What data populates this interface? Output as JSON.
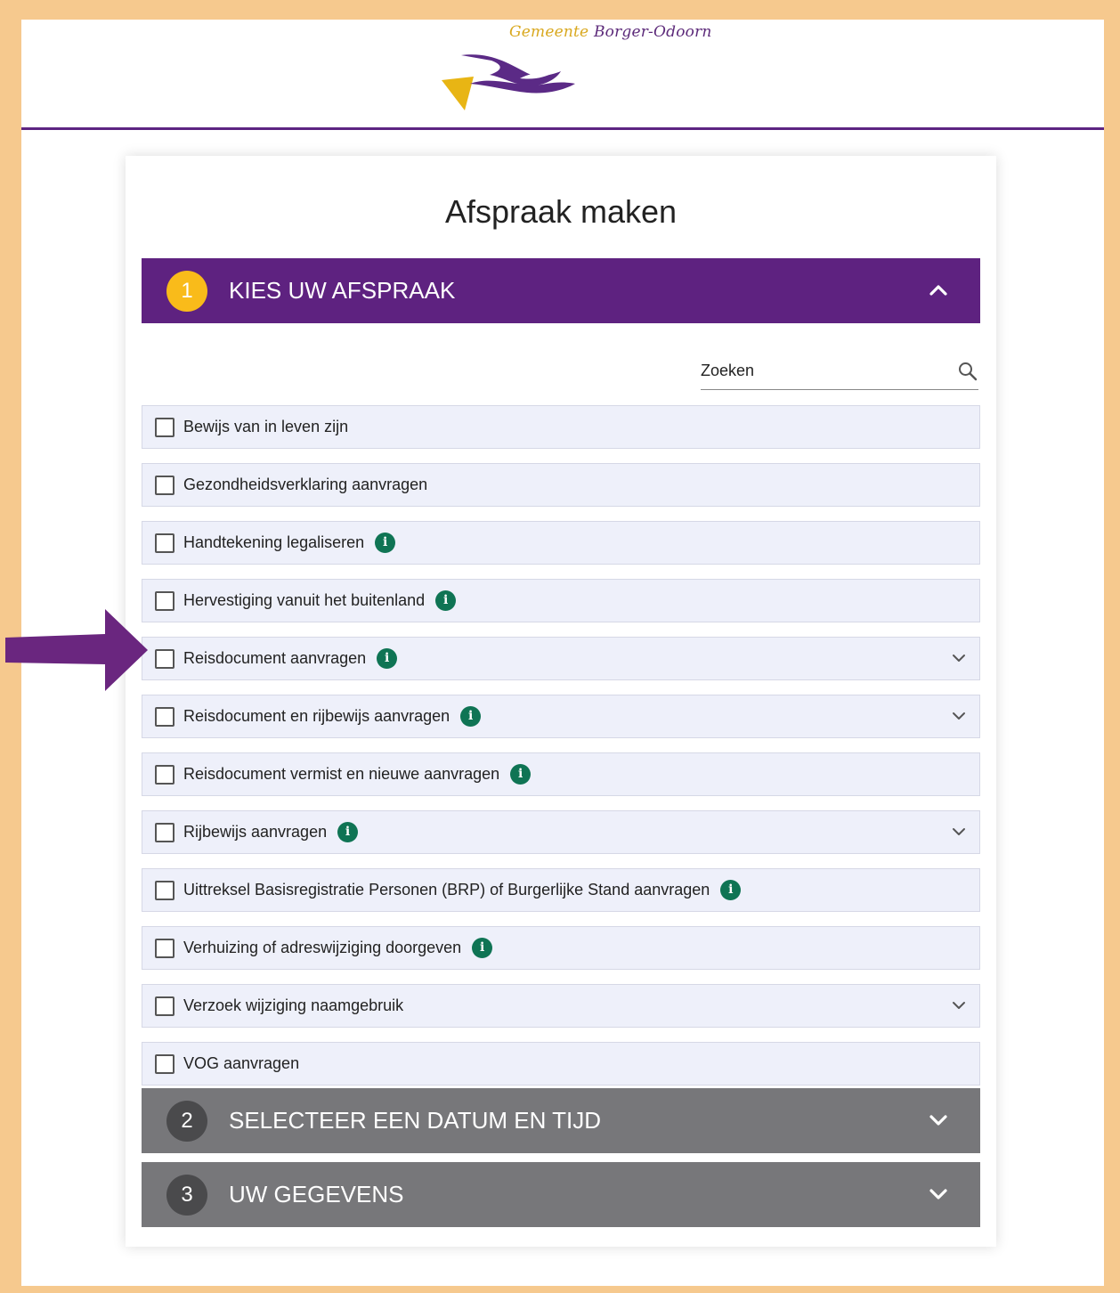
{
  "header": {
    "brand_prefix": "Gemeente",
    "brand_name": "Borger-Odoorn"
  },
  "page": {
    "title": "Afspraak maken"
  },
  "steps": [
    {
      "number": "1",
      "title": "KIES UW AFSPRAAK",
      "state": "expanded"
    },
    {
      "number": "2",
      "title": "SELECTEER EEN DATUM EN TIJD",
      "state": "collapsed"
    },
    {
      "number": "3",
      "title": "UW GEGEVENS",
      "state": "collapsed"
    }
  ],
  "search": {
    "placeholder": "Zoeken",
    "value": ""
  },
  "appointments": [
    {
      "label": "Bewijs van in leven zijn",
      "info": false,
      "expandable": false,
      "checked": false
    },
    {
      "label": "Gezondheidsverklaring aanvragen",
      "info": false,
      "expandable": false,
      "checked": false
    },
    {
      "label": "Handtekening legaliseren",
      "info": true,
      "expandable": false,
      "checked": false
    },
    {
      "label": "Hervestiging vanuit het buitenland",
      "info": true,
      "expandable": false,
      "checked": false
    },
    {
      "label": "Reisdocument aanvragen",
      "info": true,
      "expandable": true,
      "checked": false
    },
    {
      "label": "Reisdocument en rijbewijs aanvragen",
      "info": true,
      "expandable": true,
      "checked": false
    },
    {
      "label": "Reisdocument vermist en nieuwe aanvragen",
      "info": true,
      "expandable": false,
      "checked": false
    },
    {
      "label": "Rijbewijs aanvragen",
      "info": true,
      "expandable": true,
      "checked": false
    },
    {
      "label": "Uittreksel Basisregistratie Personen (BRP) of Burgerlijke Stand aanvragen",
      "info": true,
      "expandable": false,
      "checked": false
    },
    {
      "label": "Verhuizing of adreswijziging doorgeven",
      "info": true,
      "expandable": false,
      "checked": false
    },
    {
      "label": "Verzoek wijziging naamgebruik",
      "info": false,
      "expandable": true,
      "checked": false
    },
    {
      "label": "VOG aanvragen",
      "info": false,
      "expandable": false,
      "checked": false
    }
  ],
  "colors": {
    "accent_purple": "#5e2280",
    "step_badge_active": "#f9bb1a",
    "collapsed_section": "#77777a",
    "info_icon": "#0f7454",
    "page_border": "#f6c98e"
  },
  "icons": {
    "info": "info-icon",
    "search": "search-icon",
    "chevron": "chevron-icon"
  }
}
